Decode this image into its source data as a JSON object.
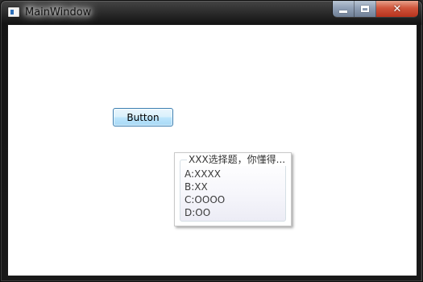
{
  "window": {
    "title": "MainWindow"
  },
  "caption_buttons": {
    "minimize_icon": "minimize-icon",
    "maximize_icon": "maximize-icon",
    "close_icon": "close-icon"
  },
  "main": {
    "button_label": "Button"
  },
  "quiz": {
    "title": "XXX选择题，你懂得...",
    "options": [
      "A:XXXX",
      "B:XX",
      "C:OOOO",
      "D:OO"
    ]
  },
  "colors": {
    "button_border": "#3c7fb1",
    "close_button": "#d0553b",
    "titlebar_text": "#111111",
    "client_background": "#ffffff"
  }
}
